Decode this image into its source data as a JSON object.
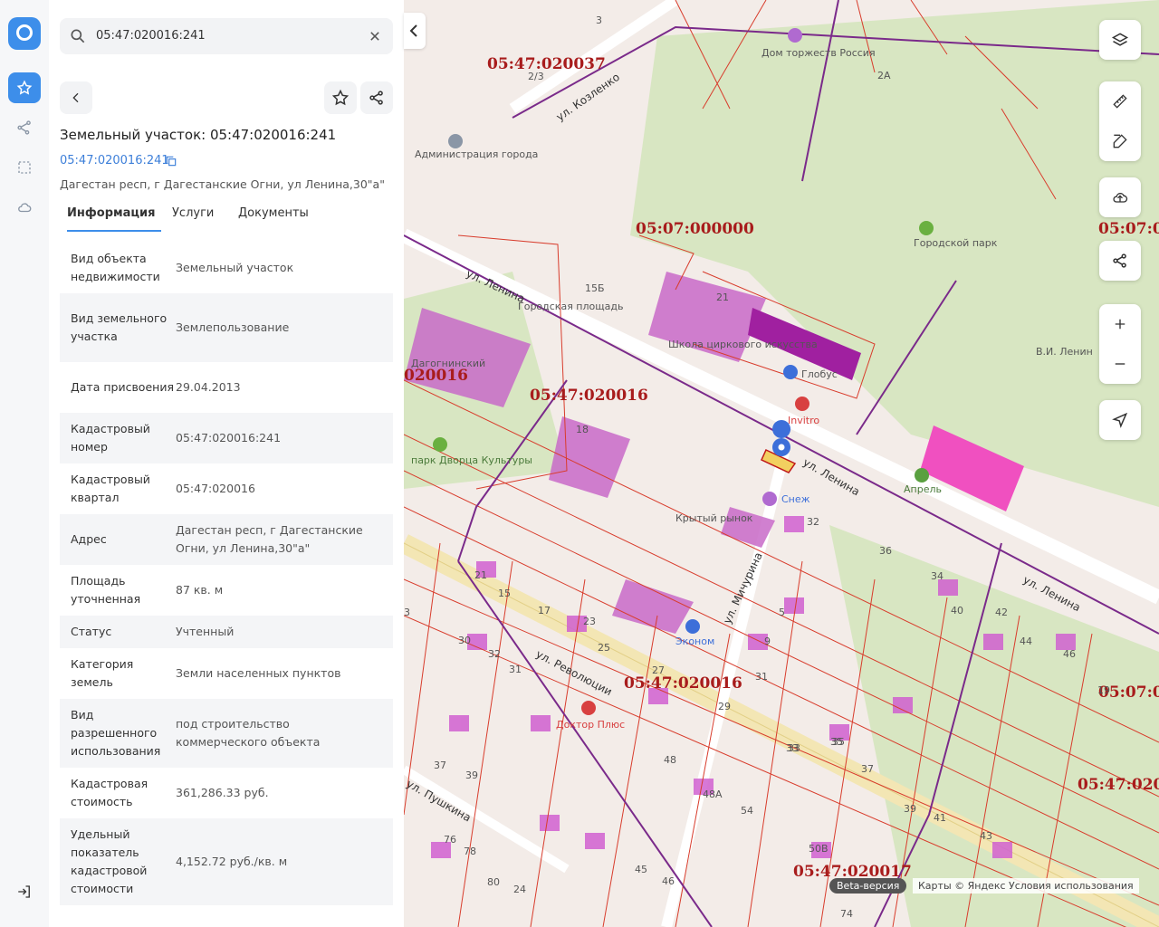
{
  "search": {
    "value": "05:47:020016:241"
  },
  "parcel": {
    "title": "Земельный участок: 05:47:020016:241",
    "cad_link": "05:47:020016:241",
    "address": "Дагестан респ, г Дагестанские Огни, ул Ленина,30\"а\""
  },
  "tabs": [
    "Информация",
    "Услуги",
    "Документы"
  ],
  "rows": [
    {
      "k": "Вид объекта недвижимости",
      "v": "Земельный участок"
    },
    {
      "k": "Вид земельного участка",
      "v": "Землепользование"
    },
    {
      "k": "Дата присвоения",
      "v": "29.04.2013"
    },
    {
      "k": "Кадастровый номер",
      "v": "05:47:020016:241"
    },
    {
      "k": "Кадастровый квартал",
      "v": "05:47:020016"
    },
    {
      "k": "Адрес",
      "v": "Дагестан респ, г Дагестанские Огни, ул Ленина,30\"а\""
    },
    {
      "k": "Площадь уточненная",
      "v": "87 кв. м"
    },
    {
      "k": "Статус",
      "v": "Учтенный"
    },
    {
      "k": "Категория земель",
      "v": "Земли населенных пунктов"
    },
    {
      "k": "Вид разрешенного использования",
      "v": "под строительство коммерческого объекта"
    },
    {
      "k": "Кадастровая стоимость",
      "v": "361,286.33 руб."
    },
    {
      "k": "Удельный показатель кадастровой стоимости",
      "v": "4,152.72 руб./кв. м"
    }
  ],
  "map": {
    "quarters": [
      "05:47:020037",
      "05:07:000000",
      "05:47:020016",
      "05:47:020016",
      "05:47:020016",
      "05:47:020017",
      "05:07:0",
      "05:07:0",
      "05:47:020",
      "020016"
    ],
    "streets": [
      "ул. Козленко",
      "ул. Ленина",
      "ул. Ленина",
      "ул. Ленина",
      "ул. Революции",
      "ул. Мичурина",
      "ул. Пушкина"
    ],
    "pois": [
      "Дом торжеств Россия",
      "Администрация города",
      "Городской парк",
      "Городская площадь",
      "Школа циркового искусства",
      "Дагогнинский",
      "Глобус",
      "Invitro",
      "В.И. Ленин",
      "парк Дворца Культуры",
      "Апрель",
      "Снеж",
      "Крытый рынок",
      "Эконом",
      "Доктор Плюс"
    ],
    "houses": [
      "3",
      "2А",
      "2/3",
      "15Б",
      "21",
      "18",
      "30",
      "32",
      "36",
      "34",
      "38",
      "40",
      "42",
      "44",
      "46",
      "19",
      "17",
      "15",
      "21",
      "23",
      "25",
      "27",
      "29",
      "28",
      "30",
      "32",
      "31",
      "33",
      "35",
      "37",
      "39",
      "41",
      "43",
      "45",
      "46",
      "48",
      "48А",
      "54",
      "50В",
      "74",
      "76",
      "78",
      "80",
      "24",
      "3",
      "5",
      "9",
      "31",
      "33",
      "35",
      "37",
      "39"
    ]
  },
  "beta": "Beta-версия",
  "attribution": "Карты © Яндекс   Условия использования"
}
